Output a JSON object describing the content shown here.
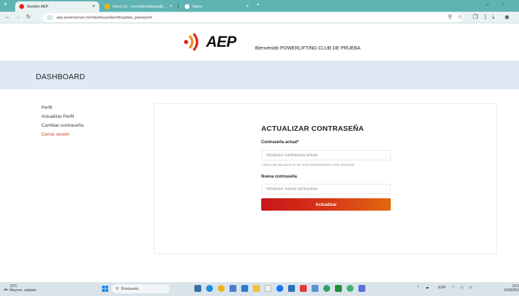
{
  "browser": {
    "tabs": [
      {
        "label": "Gestión AEP",
        "active": true
      },
      {
        "label": "Inbox (1) - correodeclubaep@...",
        "active": false
      },
      {
        "label": "Name",
        "active": false
      }
    ],
    "new_tab": "+",
    "url": "aep.powerserver.ovh/dashboard/perfil/update_password/"
  },
  "header": {
    "logo_text": "AEP",
    "welcome": "Bienvenido POWERLIFTING CLUB DE PRUEBA"
  },
  "dashboard": {
    "title": "DASHBOARD"
  },
  "sidebar": {
    "items": [
      {
        "label": "Perfil"
      },
      {
        "label": "Actualizar Perfil"
      },
      {
        "label": "Cambiar contraseña"
      },
      {
        "label": "Cerrar sesión"
      }
    ]
  },
  "form": {
    "title": "ACTUALIZAR CONTRASEÑA",
    "current_label": "Contraseña actual*",
    "current_placeholder": "Introduce contraseña actual",
    "note": "* DEJA EN BLANCO SI TE HAS REGISTRADO CON GOOGLE",
    "new_label": "Nueva contraseña",
    "new_placeholder": "Introduce nueva contraseña",
    "submit": "Actualizar"
  },
  "taskbar": {
    "temperature": "12°C",
    "weather": "Mayorm. nublado",
    "search": "Búsqueda",
    "lang": "ESP",
    "time": "19:3",
    "date": "12/03/202"
  },
  "colors": {
    "tabbar": "#5fb3b3",
    "dashboard_band": "#dfe9f6",
    "logout": "#d9322a",
    "button_start": "#c9141a",
    "button_end": "#e26a10"
  }
}
